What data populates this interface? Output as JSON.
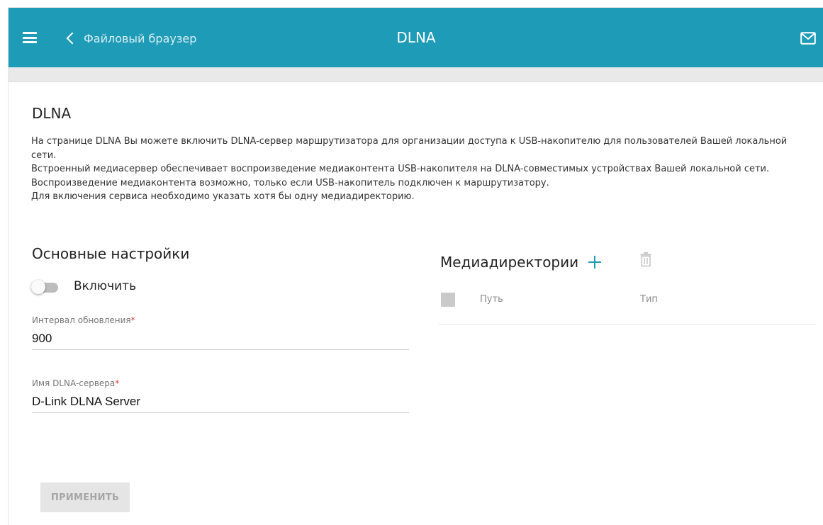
{
  "header": {
    "back_label": "Файловый браузер",
    "title": "DLNA",
    "menu_icon": "hamburger-menu-icon",
    "back_icon": "chevron-left-icon",
    "mail_icon": "mail-icon",
    "bar_color": "#1e9bb7"
  },
  "page": {
    "heading": "DLNA",
    "description": [
      "На странице DLNA Вы можете включить DLNA-сервер маршрутизатора для организации доступа к USB-накопителю для пользователей Вашей локальной сети.",
      "Встроенный медиасервер обеспечивает воспроизведение медиаконтента USB-накопителя на DLNA-совместимых устройствах Вашей локальной сети. Воспроизведение медиаконтента возможно, только если USB-накопитель подключен к маршрутизатору.",
      "Для включения сервиса необходимо указать хотя бы одну медиадиректорию."
    ]
  },
  "settings": {
    "title": "Основные настройки",
    "enable_label": "Включить",
    "enabled": false,
    "update_interval": {
      "label": "Интервал обновления",
      "required_mark": "*",
      "value": "900"
    },
    "server_name": {
      "label": "Имя DLNA-сервера",
      "required_mark": "*",
      "value": "D-Link DLNA Server"
    },
    "apply_label": "ПРИМЕНИТЬ"
  },
  "media": {
    "title": "Медиадиректории",
    "add_icon": "plus-icon",
    "delete_icon": "trash-icon",
    "columns": [
      "Путь",
      "Тип"
    ],
    "rows": []
  }
}
